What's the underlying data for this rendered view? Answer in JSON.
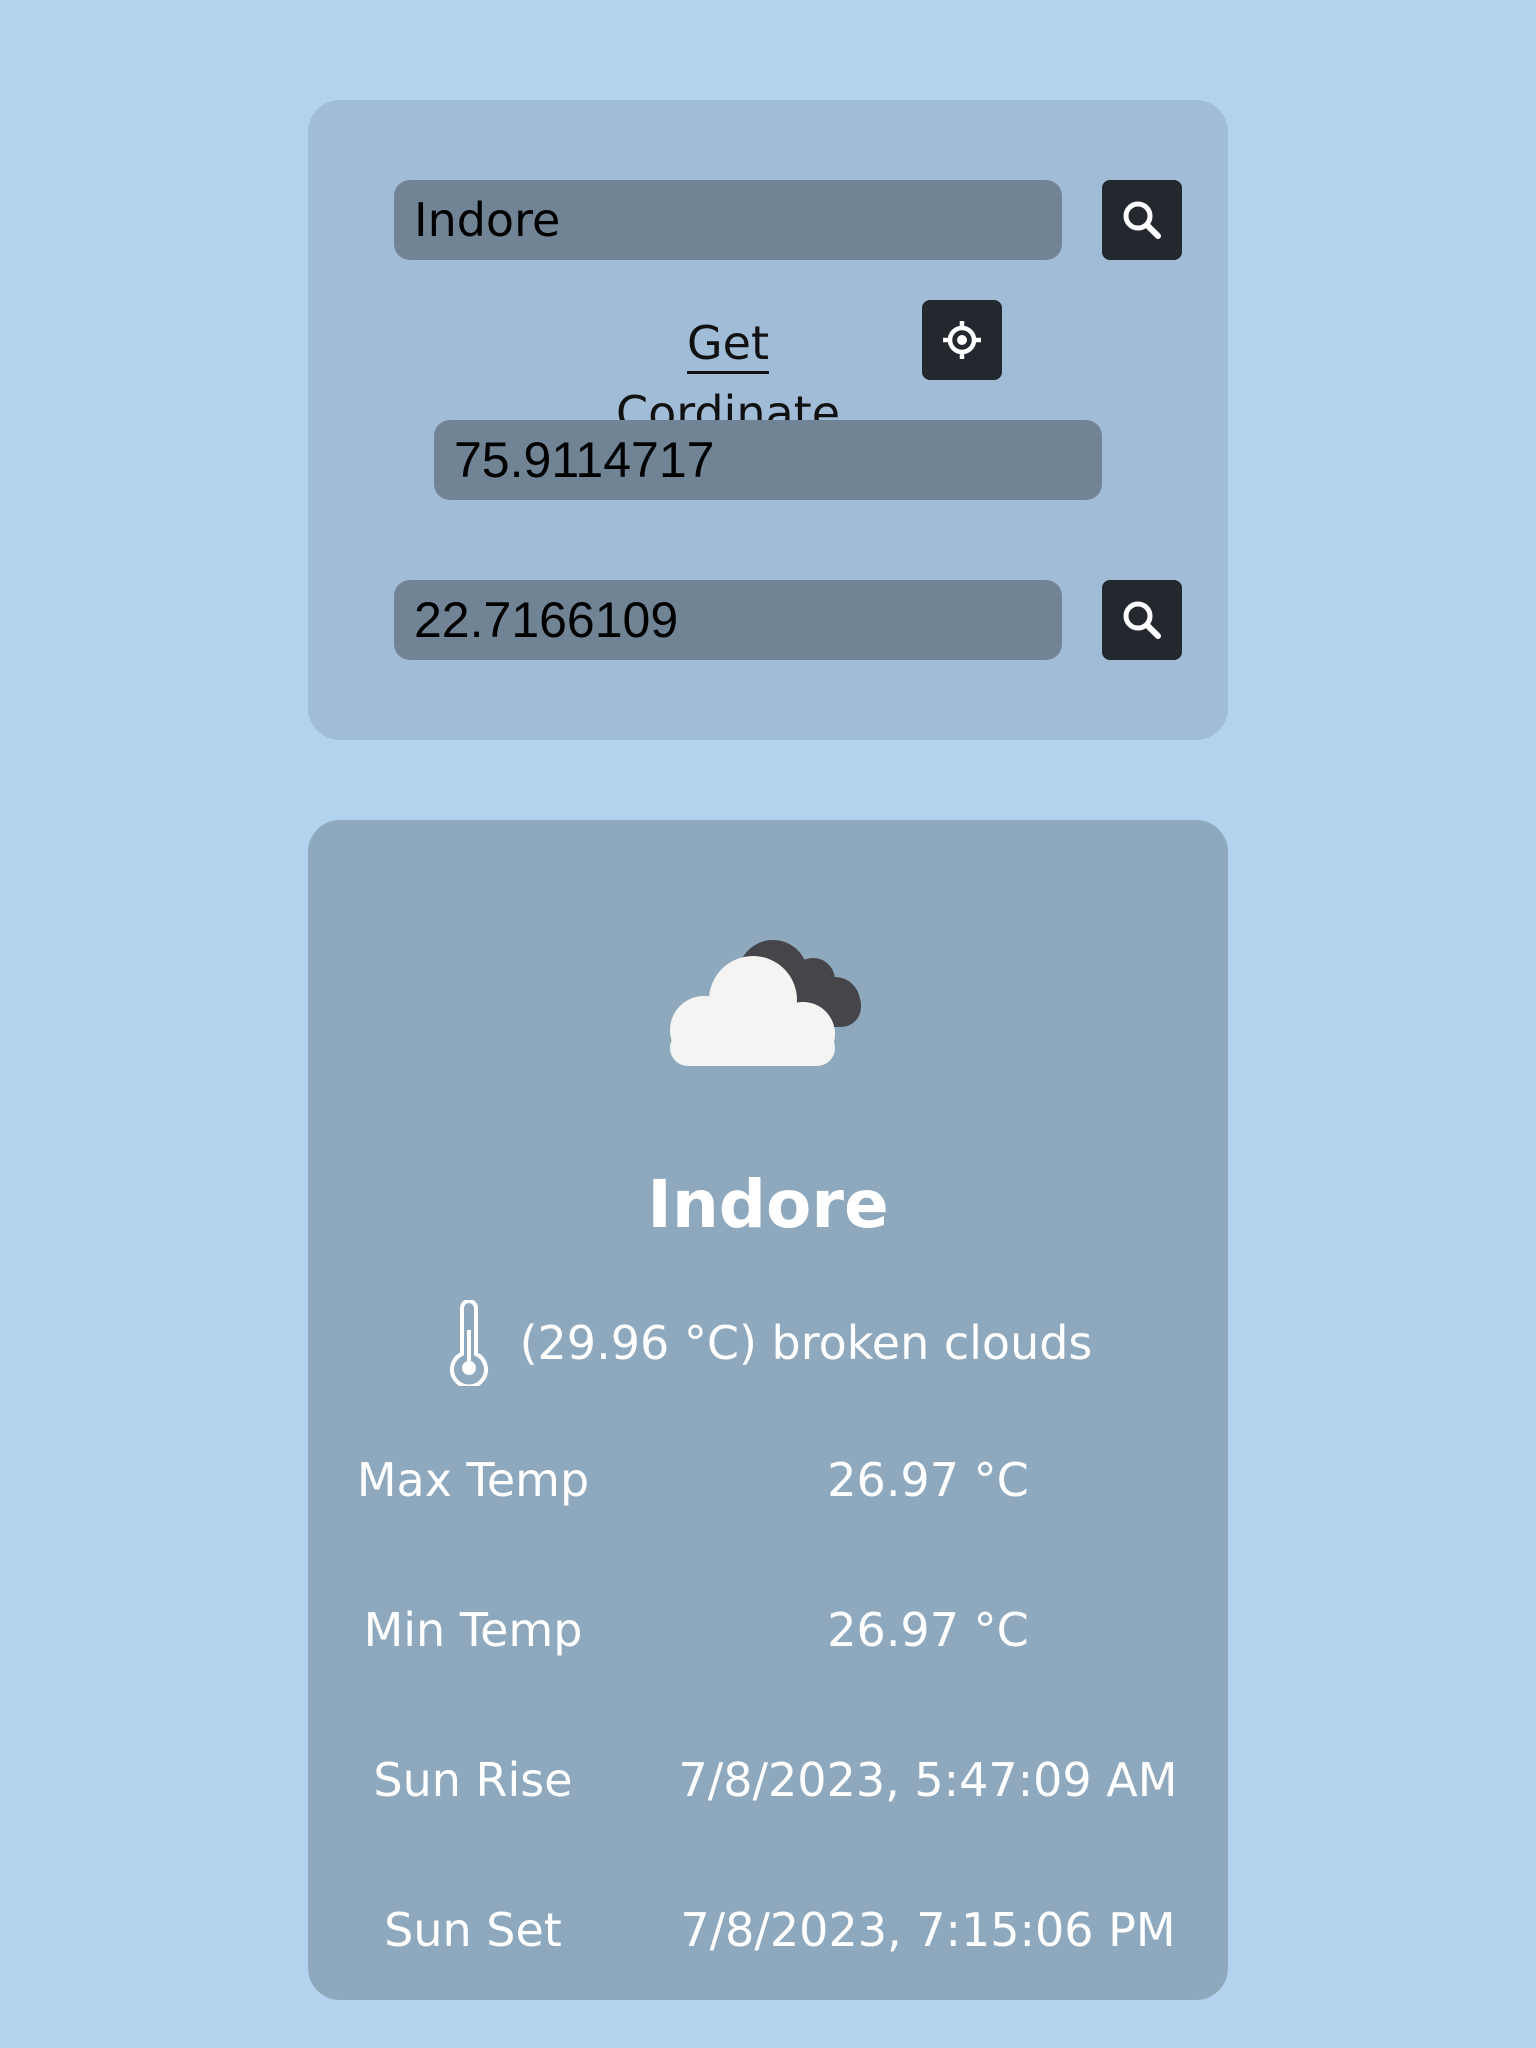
{
  "search": {
    "city_value": "Indore",
    "get_coordinate_label": "Get Cordinate",
    "longitude_value": "75.9114717",
    "latitude_value": "22.7166109"
  },
  "weather": {
    "icon": "broken-clouds-icon",
    "city": "Indore",
    "description": "(29.96 °C) broken clouds",
    "stats": [
      {
        "label": "Max Temp",
        "value": "26.97 °C"
      },
      {
        "label": "Min Temp",
        "value": "26.97 °C"
      },
      {
        "label": "Sun Rise",
        "value": "7/8/2023, 5:47:09 AM"
      },
      {
        "label": "Sun Set",
        "value": "7/8/2023, 7:15:06 PM"
      }
    ]
  },
  "colors": {
    "page_background": "#b3d2ee",
    "search_card": "#a1bcd6",
    "weather_card": "#8ea9bd",
    "input_field": "#708496",
    "button": "#23282f"
  }
}
